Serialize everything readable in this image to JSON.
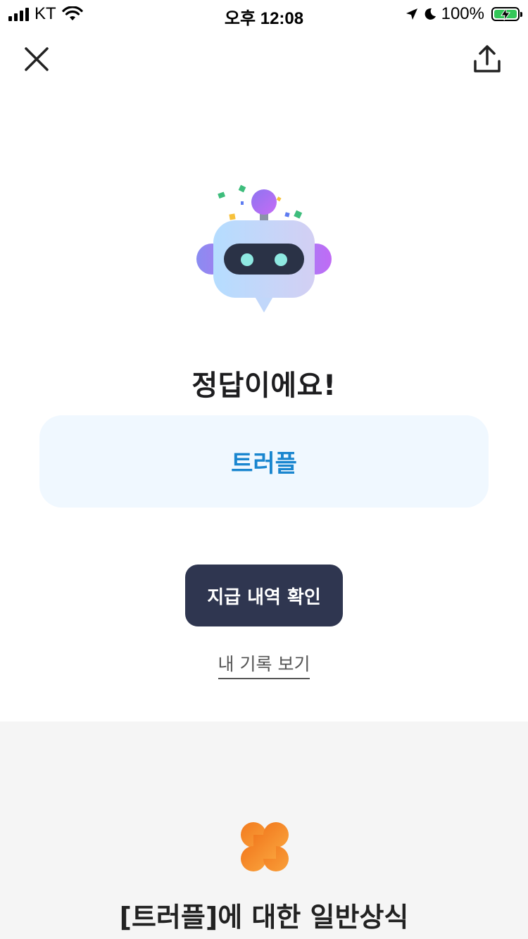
{
  "status_bar": {
    "carrier": "KT",
    "time": "오후 12:08",
    "battery": "100%",
    "icons": [
      "signal-icon",
      "wifi-icon",
      "location-arrow-icon",
      "moon-icon",
      "battery-charging-icon"
    ]
  },
  "nav": {
    "close_icon": "close-icon",
    "share_icon": "share-upload-icon"
  },
  "result": {
    "mascot": "robot-mascot",
    "title": "정답이에요!",
    "answer": "트러플"
  },
  "actions": {
    "primary_label": "지급 내역 확인",
    "secondary_label": "내 기록 보기"
  },
  "info": {
    "icon": "clover-icon",
    "title": "[트러플]에 대한 일반상식"
  },
  "colors": {
    "accent_blue": "#1a86cf",
    "answer_card_bg": "#f0f8ff",
    "primary_button_bg": "#2f3650",
    "section_bg": "#f5f5f5",
    "clover_orange": "#f48a2a"
  }
}
